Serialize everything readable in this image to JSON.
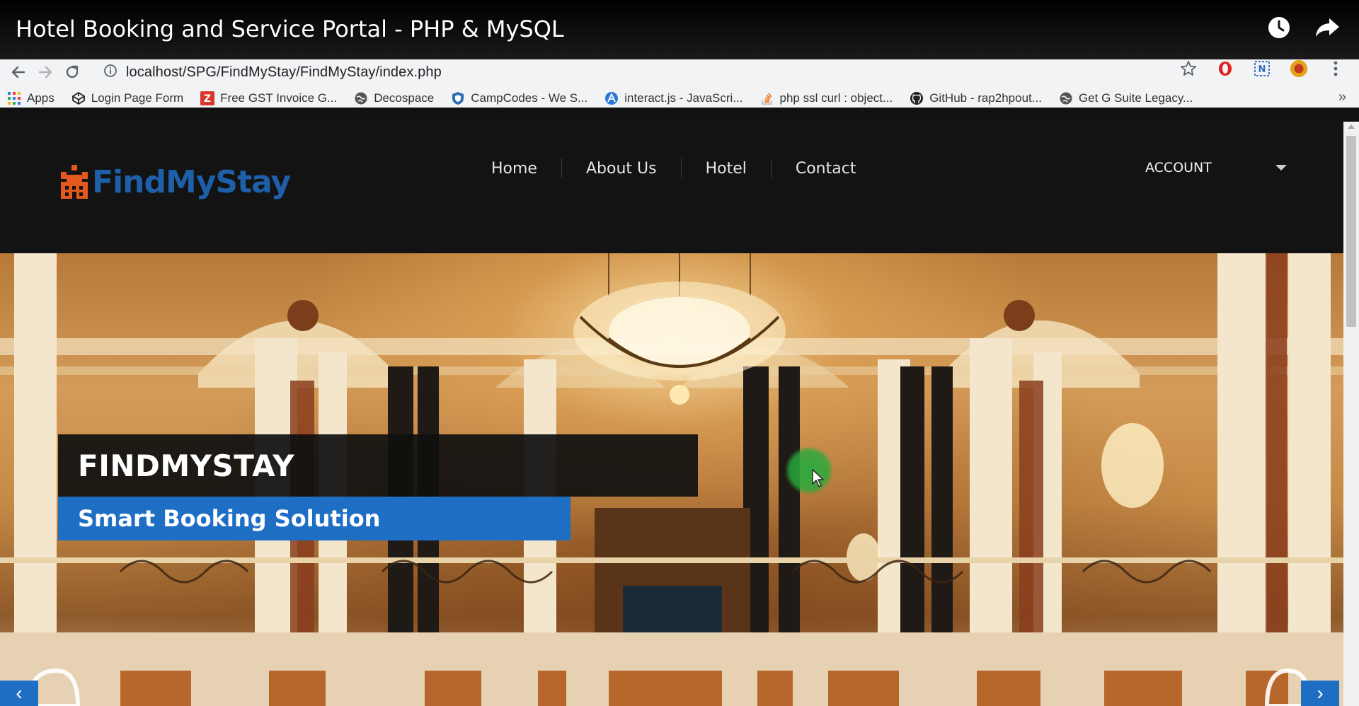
{
  "video": {
    "title": "Hotel Booking and Service Portal - PHP & MySQL",
    "actions": [
      "clock-icon",
      "share-icon"
    ]
  },
  "browser": {
    "url": "localhost/SPG/FindMyStay/FindMyStay/index.php",
    "bookmarks": [
      {
        "label": "Apps",
        "icon": "apps-grid-icon"
      },
      {
        "label": "Login Page Form",
        "icon": "codepen-icon"
      },
      {
        "label": "Free GST Invoice G...",
        "icon": "zoho-icon"
      },
      {
        "label": "Decospace",
        "icon": "globe-icon"
      },
      {
        "label": "CampCodes - We S...",
        "icon": "shield-icon"
      },
      {
        "label": "interact.js - JavaScri...",
        "icon": "interact-icon"
      },
      {
        "label": "php ssl curl : object...",
        "icon": "stack-icon"
      },
      {
        "label": "GitHub - rap2hpout...",
        "icon": "github-icon"
      },
      {
        "label": "Get G Suite Legacy...",
        "icon": "globe-icon"
      }
    ],
    "more_label": "»"
  },
  "site": {
    "logo_text": "FindMyStay",
    "nav": [
      "Home",
      "About Us",
      "Hotel",
      "Contact"
    ],
    "account_label": "ACCOUNT"
  },
  "hero": {
    "title": "FINDMYSTAY",
    "subtitle": "Smart Booking Solution",
    "prev_label": "‹",
    "next_label": "›"
  },
  "colors": {
    "brand_blue": "#1e6fc4",
    "header_bg": "#131313"
  }
}
